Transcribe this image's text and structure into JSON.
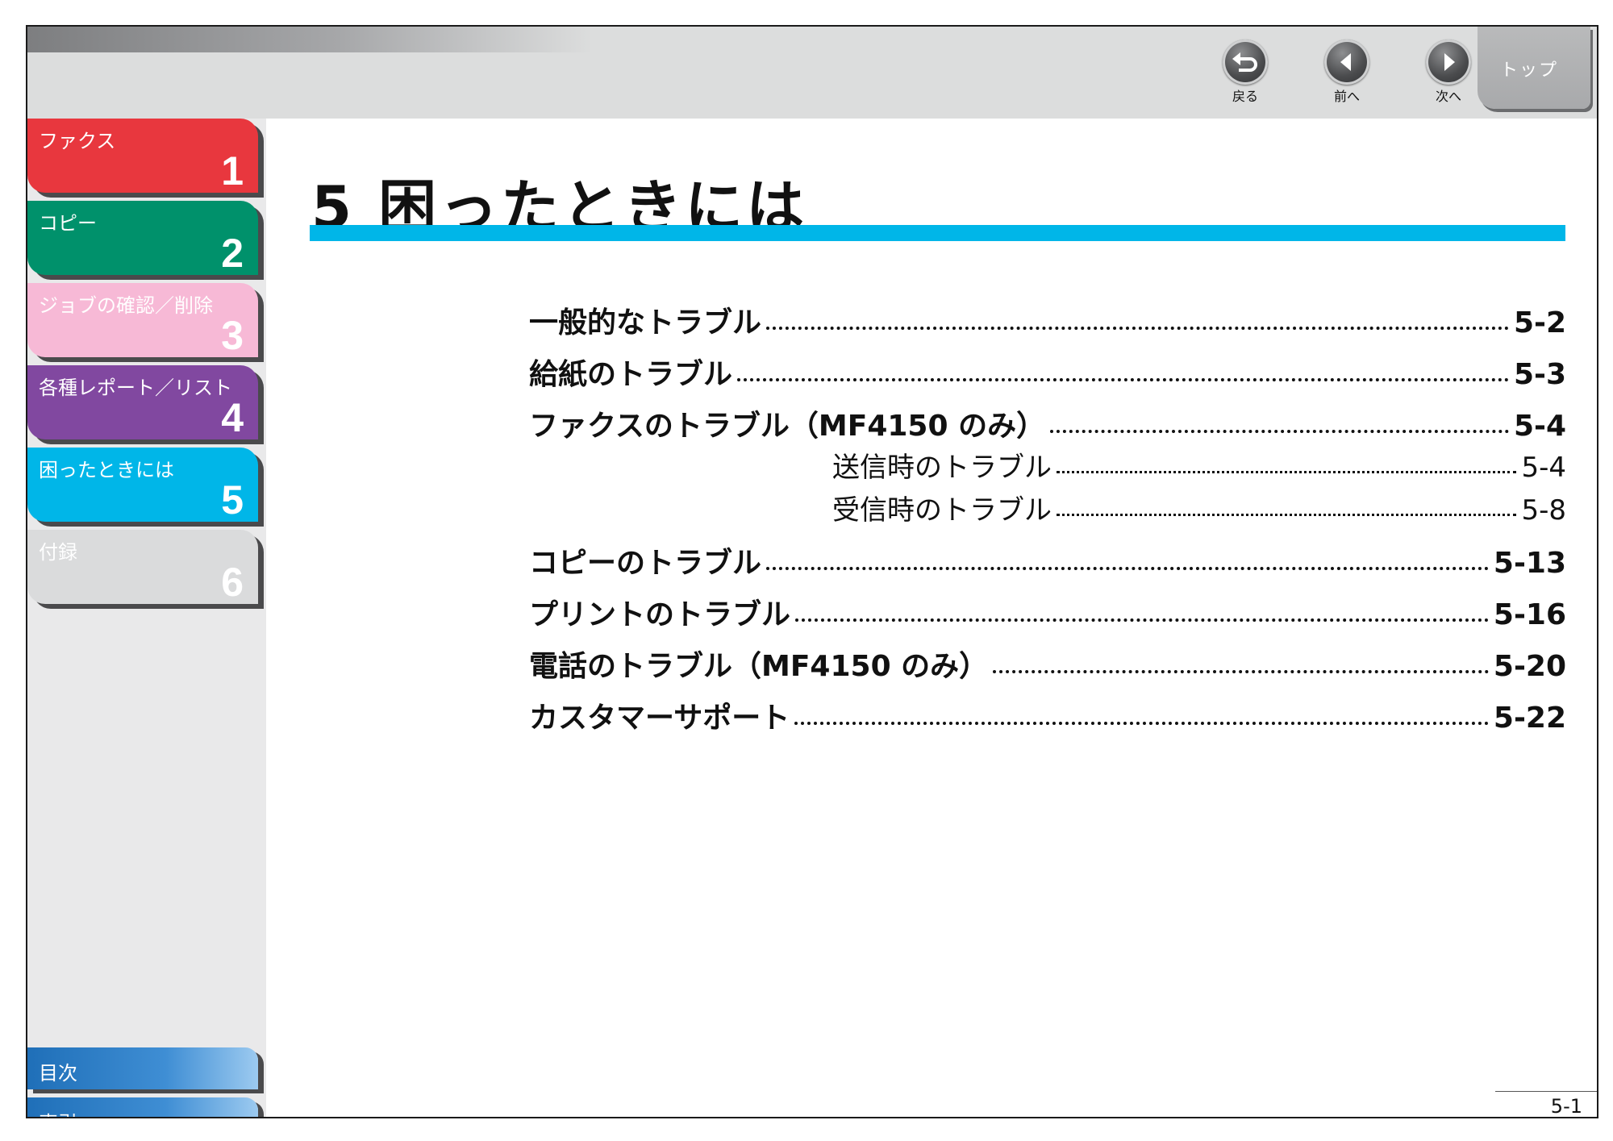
{
  "nav": {
    "back_label": "戻る",
    "prev_label": "前へ",
    "next_label": "次へ",
    "top_label": "トップ"
  },
  "sidebar": {
    "chapters": [
      {
        "title": "ファクス",
        "number": "1",
        "color": "#e8373e"
      },
      {
        "title": "コピー",
        "number": "2",
        "color": "#00916b"
      },
      {
        "title": "ジョブの確認／削除",
        "number": "3",
        "color": "#f7b9d6"
      },
      {
        "title": "各種レポート／リスト",
        "number": "4",
        "color": "#8148a0"
      },
      {
        "title": "困ったときには",
        "number": "5",
        "color": "#00b6e8"
      },
      {
        "title": "付録",
        "number": "6",
        "color": "#dadbdc"
      }
    ],
    "contents_label": "目次",
    "index_label": "索引"
  },
  "main": {
    "title": "5 困ったときには",
    "accent_color": "#00b6e8",
    "toc": [
      {
        "text": "一般的なトラブル",
        "page": "5-2"
      },
      {
        "text": "給紙のトラブル",
        "page": "5-3"
      },
      {
        "text": "ファクスのトラブル（MF4150 のみ）",
        "page": "5-4"
      },
      {
        "text": "送信時のトラブル",
        "page": "5-4"
      },
      {
        "text": "受信時のトラブル",
        "page": "5-8"
      },
      {
        "text": "コピーのトラブル",
        "page": "5-13"
      },
      {
        "text": "プリントのトラブル",
        "page": "5-16"
      },
      {
        "text": "電話のトラブル（MF4150 のみ）",
        "page": "5-20"
      },
      {
        "text": "カスタマーサポート",
        "page": "5-22"
      }
    ]
  },
  "footer": {
    "page_number": "5-1"
  }
}
